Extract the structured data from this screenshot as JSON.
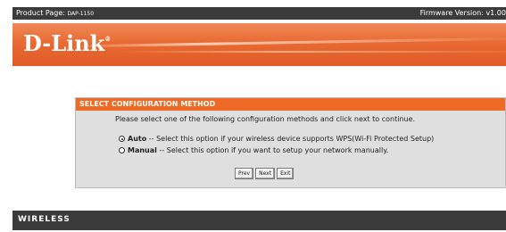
{
  "header": {
    "product_label": "Product Page:",
    "product_model": "DAP-1150",
    "firmware_label": "Firmware Version: v1.00"
  },
  "brand": {
    "logo_text": "D-Link",
    "registered_mark": "®",
    "bar_color": "#e86a33"
  },
  "panel": {
    "title": "SELECT CONFIGURATION METHOD",
    "header_color": "#ee6a25",
    "instruction": "Please select one of the following configuration methods and click next to continue.",
    "options": [
      {
        "name": "Auto",
        "description": "-- Select this option if your wireless device supports WPS(Wi-Fi Protected Setup)",
        "selected": true
      },
      {
        "name": "Manual",
        "description": "-- Select this option if you want to setup your network manually.",
        "selected": false
      }
    ],
    "buttons": {
      "prev": "Prev",
      "next": "Next",
      "exit": "Exit"
    }
  },
  "footer": {
    "label": "WIRELESS"
  }
}
